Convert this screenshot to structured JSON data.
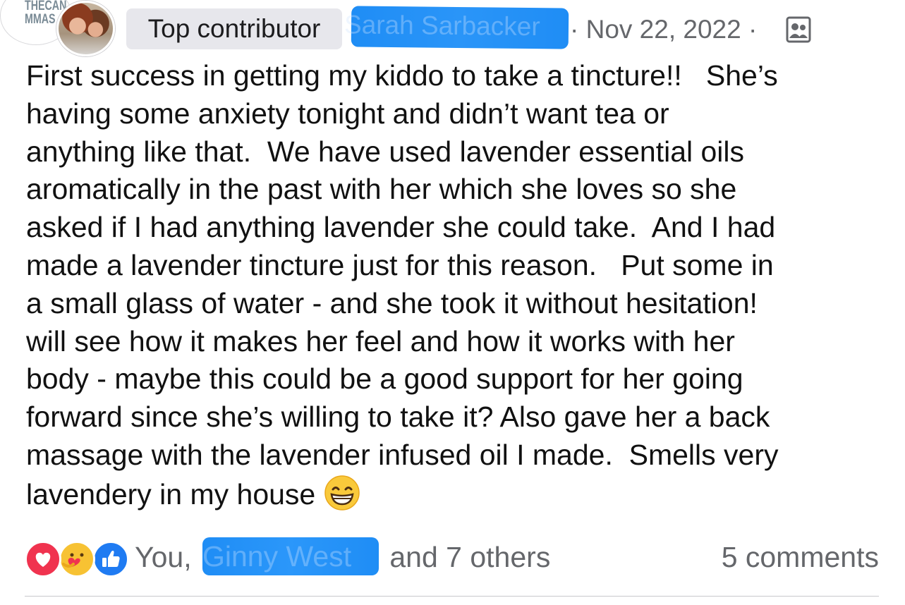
{
  "group": {
    "logo_text": "THECAN\nMMAS"
  },
  "author": {
    "badge": "Top contributor",
    "name_redacted": "Sarah Sarbacker"
  },
  "post": {
    "date": "· Nov 22, 2022 ·",
    "audience_icon": "group-members-icon",
    "body": "First success in getting my kiddo to take a tincture!!   She’s\nhaving some anxiety tonight and didn’t want tea or\nanything like that.  We have used lavender essential oils\naromatically in the past with her which she loves so she\nasked if I had anything lavender she could take.  And I had\nmade a lavender tincture just for this reason.   Put some in\na small glass of water - and she took it without hesitation!\nwill see how it makes her feel and how it works with her\nbody - maybe this could be a good support for her going\nforward since she’s willing to take it? Also gave her a back\nmassage with the lavender infused oil I made.  Smells very\nlavendery in my house ",
    "trailing_emoji": "grinning-face-with-smiling-eyes"
  },
  "engagement": {
    "reaction_icons": [
      "love-icon",
      "care-icon",
      "like-icon"
    ],
    "names_prefix": "You, ",
    "redacted_friend": "Ginny West",
    "names_suffix": " and 7 others",
    "comments": "5 comments"
  },
  "colors": {
    "redaction": "#1f8df5",
    "meta_text": "#65676b",
    "badge_bg": "#e7e7ec"
  }
}
